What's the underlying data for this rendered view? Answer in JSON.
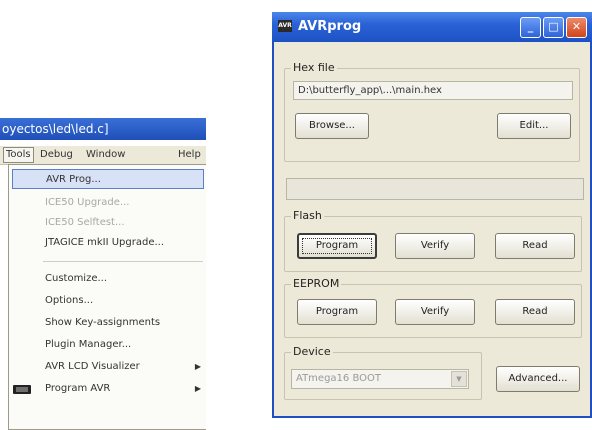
{
  "ide": {
    "title": "oyectos\\led\\led.c]",
    "menubar": [
      "Tools",
      "Debug",
      "Window",
      "Help"
    ],
    "menu_items": [
      {
        "label": "AVR Prog...",
        "state": "highlighted"
      },
      {
        "label": "ICE50 Upgrade...",
        "state": "disabled"
      },
      {
        "label": "ICE50 Selftest...",
        "state": "disabled"
      },
      {
        "label": "JTAGICE mkII Upgrade...",
        "state": "normal"
      },
      {
        "label": "Customize...",
        "state": "normal"
      },
      {
        "label": "Options...",
        "state": "normal"
      },
      {
        "label": "Show Key-assignments",
        "state": "normal"
      },
      {
        "label": "Plugin Manager...",
        "state": "normal"
      },
      {
        "label": "AVR LCD Visualizer",
        "state": "submenu"
      },
      {
        "label": "Program AVR",
        "state": "submenu"
      }
    ]
  },
  "avrprog": {
    "title": "AVRprog",
    "icon_text": "AVR",
    "window_buttons": {
      "minimize": "_",
      "maximize": "□",
      "close": "✕"
    },
    "hexfile": {
      "label": "Hex file",
      "path": "D:\\butterfly_app\\...\\main.hex",
      "browse": "Browse...",
      "edit": "Edit..."
    },
    "flash": {
      "label": "Flash",
      "program": "Program",
      "verify": "Verify",
      "read": "Read"
    },
    "eeprom": {
      "label": "EEPROM",
      "program": "Program",
      "verify": "Verify",
      "read": "Read"
    },
    "device": {
      "label": "Device",
      "selected": "ATmega16 BOOT",
      "advanced": "Advanced..."
    }
  },
  "colors": {
    "titlebar": "#2a62d6",
    "dialog_bg": "#ece9d8",
    "menu_highlight": "#d8e2f6"
  }
}
